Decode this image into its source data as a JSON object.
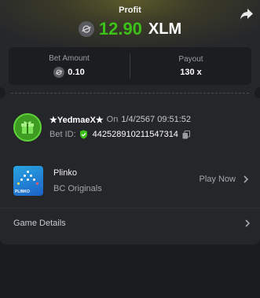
{
  "header": {
    "label": "Profit",
    "amount": "12.90",
    "currency": "XLM",
    "amount_color": "#3bc117"
  },
  "stats": {
    "bet_amount_label": "Bet Amount",
    "bet_amount_value": "0.10",
    "payout_label": "Payout",
    "payout_value": "130 x"
  },
  "user": {
    "name": "★YedmaeX★",
    "on_label": "On",
    "timestamp": "1/4/2567 09:51:52",
    "bet_id_label": "Bet ID:",
    "bet_id": "442528910211547314"
  },
  "game": {
    "title": "Plinko",
    "provider": "BC Originals",
    "thumb_label": "PLINKO",
    "play_label": "Play Now"
  },
  "details": {
    "label": "Game Details"
  },
  "icons": [
    "share-icon",
    "xlm-coin-icon",
    "gift-avatar-icon",
    "verified-shield-icon",
    "copy-icon",
    "chevron-right-icon"
  ]
}
